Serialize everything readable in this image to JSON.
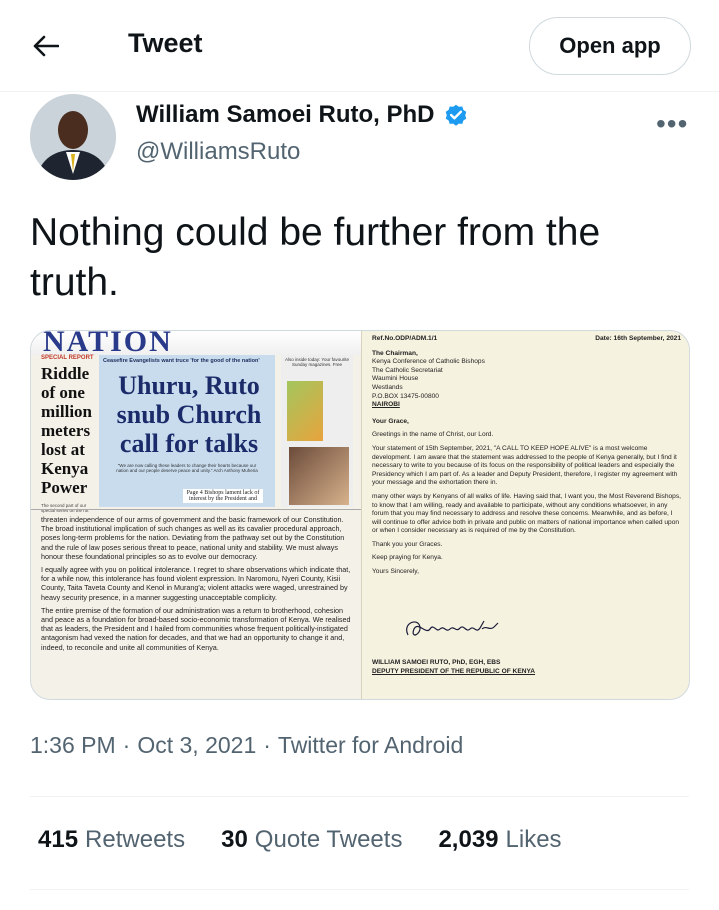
{
  "header": {
    "title": "Tweet",
    "open_app": "Open app"
  },
  "author": {
    "name": "William Samoei Ruto, PhD",
    "handle": "@WilliamsRuto",
    "verified": true
  },
  "tweet": {
    "text": "Nothing could be further from the truth.",
    "timestamp": "1:36 PM",
    "date": "Oct 3, 2021",
    "client": "Twitter for Android",
    "sep": "·"
  },
  "stats": [
    {
      "count": "415",
      "label": "Retweets"
    },
    {
      "count": "30",
      "label": "Quote Tweets"
    },
    {
      "count": "2,039",
      "label": "Likes"
    }
  ],
  "media": {
    "newspaper": {
      "masthead": "NATION",
      "section": "SPECIAL REPORT",
      "side_story": "Riddle of one million meters lost at Kenya Power",
      "side_sub": "The second part of our special series on the rot",
      "kicker": "Ceasefire Evangelists want truce 'for the good of the nation'",
      "headline": "Uhuru, Ruto snub Church call for talks",
      "quote": "\"We are now calling these leaders to change their hearts because our nation and our people deserve peace and unity.\" Arch Anthony Muheria",
      "inside": "Page 4 Bishops lament lack of interest by the President and",
      "promo": "Also inside today: Your favourite Sunday magazines. Free",
      "body": [
        "threaten independence of our arms of government and the basic framework of our Constitution. The broad institutional implication of such changes as well as its cavalier procedural approach, poses long-term problems for the nation. Deviating from the pathway set out by the Constitution and the rule of law poses serious threat to peace, national unity and stability. We must always honour these foundational principles so as to evolve our democracy.",
        "I equally agree with you on political intolerance. I regret to share observations which indicate that, for a while now, this intolerance has found violent expression. In Naromoru, Nyeri County, Kisii County, Taita Taveta County and Kenol in Murang'a; violent attacks were waged, unrestrained by heavy security presence, in a manner suggesting unacceptable complicity.",
        "The entire premise of the formation of our administration was a return to brotherhood, cohesion and peace as a foundation for broad-based socio-economic transformation of Kenya. We realised that as leaders, the President and I hailed from communities whose frequent politically-instigated antagonism had vexed the nation for decades, and that we had an opportunity to change it and, indeed, to reconcile and unite all communities of Kenya."
      ]
    },
    "letter": {
      "ref": "Ref.No.ODP/ADM.1/1",
      "date": "Date: 16th September, 2021",
      "address": [
        "The Chairman,",
        "Kenya Conference of Catholic Bishops",
        "The Catholic Secretariat",
        "Waumini House",
        "Westlands",
        "P.O.BOX 13475-00800",
        "NAIROBI"
      ],
      "salutation": "Your Grace,",
      "greeting": "Greetings in the name of Christ, our Lord.",
      "para1": "Your statement of 15th September, 2021, \"A CALL TO KEEP HOPE ALIVE\" is a most welcome development. I am aware that the statement was addressed to the people of Kenya generally, but I find it necessary to write to you because of its focus on the responsibility of political leaders and especially the Presidency which I am part of. As a leader and Deputy President, therefore, I register my agreement with your message and the exhortation there in.",
      "para2": "many other ways by Kenyans of all walks of life. Having said that, I want you, the Most Reverend Bishops, to know that I am willing, ready and available to participate, without any conditions whatsoever, in any forum that you may find necessary to address and resolve these concerns. Meanwhile, and as before, I will continue to offer advice both in private and public on matters of national importance when called upon or when I consider necessary as is required of me by the Constitution.",
      "thanks": "Thank you your Graces.",
      "praying": "Keep praying for Kenya.",
      "closing": "Yours Sincerely,",
      "signer": "WILLIAM SAMOEI RUTO, PhD, EGH, EBS",
      "title": "DEPUTY PRESIDENT OF THE REPUBLIC OF KENYA"
    }
  },
  "colors": {
    "text": "#0f1419",
    "muted": "#536471",
    "verified": "#1d9bf0",
    "border": "#cfd9de"
  }
}
